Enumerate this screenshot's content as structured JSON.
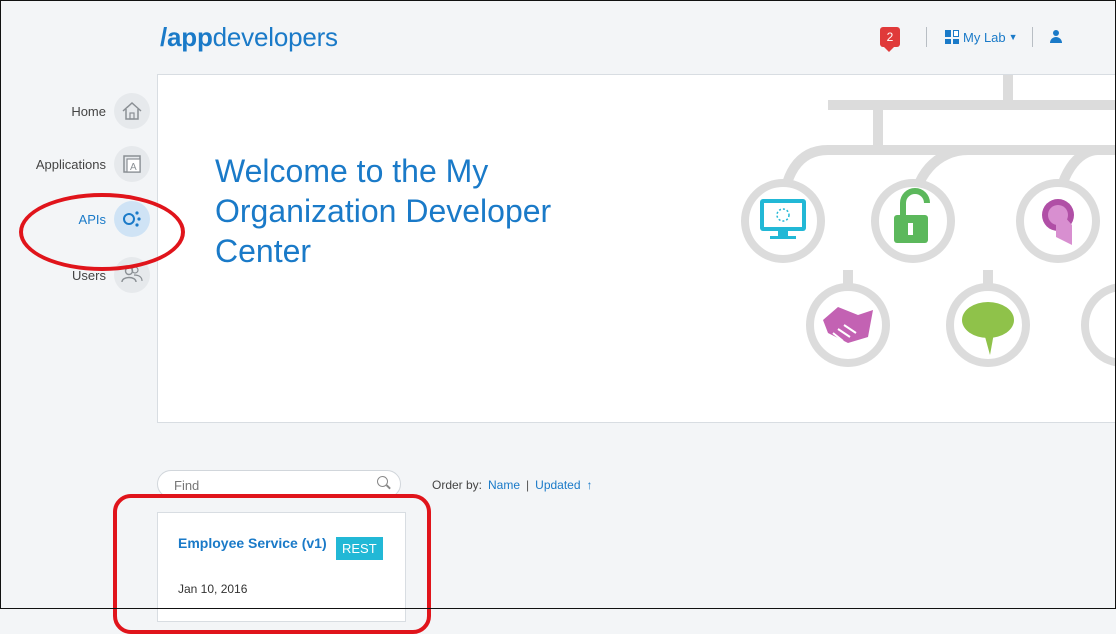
{
  "header": {
    "logo_slash": "/",
    "logo_bold": "app",
    "logo_rest": "developers",
    "notification_count": "2",
    "mylab_label": "My Lab"
  },
  "sidebar": {
    "items": [
      {
        "label": "Home",
        "icon": "home-icon"
      },
      {
        "label": "Applications",
        "icon": "applications-icon"
      },
      {
        "label": "APIs",
        "icon": "apis-icon",
        "active": true
      },
      {
        "label": "Users",
        "icon": "users-icon"
      }
    ]
  },
  "hero": {
    "title": "Welcome to the My Organization Developer Center"
  },
  "search": {
    "placeholder": "Find"
  },
  "order": {
    "label": "Order by:",
    "name": "Name",
    "separator": "|",
    "updated": "Updated",
    "arrow": "↑"
  },
  "cards": [
    {
      "title": "Employee Service (v1)",
      "badge": "REST",
      "date": "Jan 10, 2016"
    }
  ],
  "colors": {
    "accent": "#1a7ac8",
    "highlight": "#e0141b",
    "badge": "#22b8d6",
    "notification": "#e03a3a"
  }
}
